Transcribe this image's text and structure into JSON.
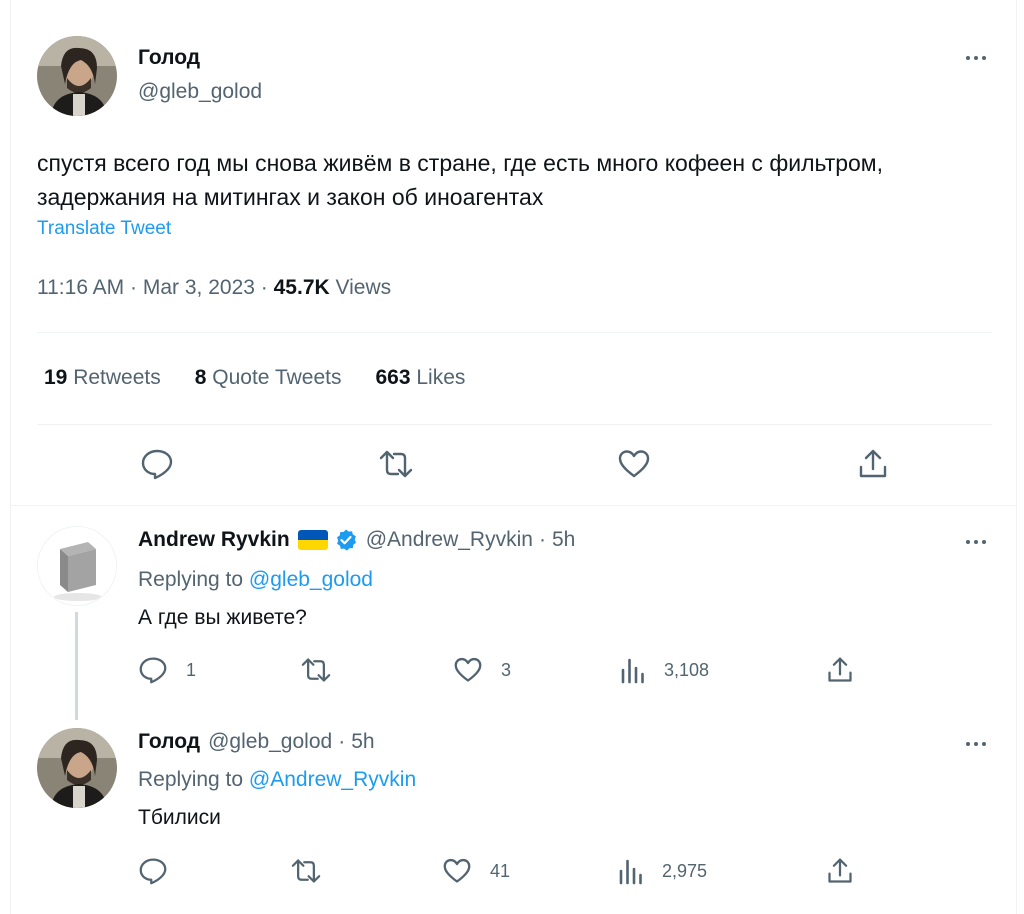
{
  "main_tweet": {
    "author_name": "Голод",
    "author_handle": "@gleb_golod",
    "text": "спустя всего год мы снова живём в стране, где есть много кофеен с фильтром, задержания на митингах и закон об иноагентах",
    "translate_label": "Translate Tweet",
    "time": "11:16 AM",
    "date": "Mar 3, 2023",
    "views_count": "45.7K",
    "views_label": "Views",
    "separator": "·",
    "stats": [
      {
        "count": "19",
        "label": "Retweets"
      },
      {
        "count": "8",
        "label": "Quote Tweets"
      },
      {
        "count": "663",
        "label": "Likes"
      }
    ],
    "actions": [
      "reply-icon",
      "retweet-icon",
      "like-icon",
      "share-icon"
    ]
  },
  "replies": [
    {
      "author_name": "Andrew Ryvkin",
      "author_handle": "@Andrew_Ryvkin",
      "time": "5h",
      "separator": "·",
      "replying_label": "Replying to",
      "replying_to": "@gleb_golod",
      "text": "А где вы живете?",
      "reply_count": "1",
      "retweet_count": "",
      "like_count": "3",
      "view_count": "3,108",
      "flag_colors": [
        "#0057b7",
        "#ffd700"
      ],
      "verified": true
    },
    {
      "author_name": "Голод",
      "author_handle": "@gleb_golod",
      "time": "5h",
      "separator": "·",
      "replying_label": "Replying to",
      "replying_to": "@Andrew_Ryvkin",
      "text": "Тбилиси",
      "reply_count": "",
      "retweet_count": "",
      "like_count": "41",
      "view_count": "2,975"
    }
  ],
  "colors": {
    "text": "#0f1419",
    "secondary": "#536471",
    "link": "#1d9bf0",
    "divider": "#eff3f4"
  }
}
